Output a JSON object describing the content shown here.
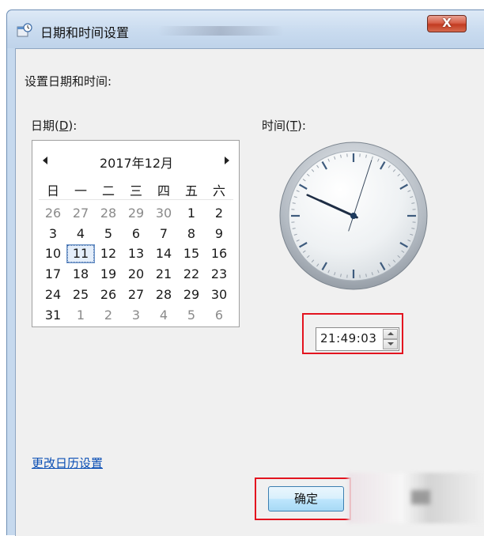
{
  "window": {
    "title": "日期和时间设置",
    "close_symbol": "X",
    "title_icon": "calendar-clock-icon"
  },
  "dialog": {
    "instruction": "设置日期和时间:",
    "date_label_text": "日期(",
    "date_label_key": "D",
    "date_label_end": "):",
    "time_label_text": "时间(",
    "time_label_key": "T",
    "time_label_end": "):"
  },
  "calendar": {
    "month_title": "2017年12月",
    "weekdays": [
      "日",
      "一",
      "二",
      "三",
      "四",
      "五",
      "六"
    ],
    "weeks": [
      [
        "26",
        "27",
        "28",
        "29",
        "30",
        "1",
        "2"
      ],
      [
        "3",
        "4",
        "5",
        "6",
        "7",
        "8",
        "9"
      ],
      [
        "10",
        "11",
        "12",
        "13",
        "14",
        "15",
        "16"
      ],
      [
        "17",
        "18",
        "19",
        "20",
        "21",
        "22",
        "23"
      ],
      [
        "24",
        "25",
        "26",
        "27",
        "28",
        "29",
        "30"
      ],
      [
        "31",
        "1",
        "2",
        "3",
        "4",
        "5",
        "6"
      ]
    ],
    "selected_day": "11"
  },
  "clock": {
    "hour": 21,
    "minute": 49,
    "second": 3
  },
  "time_input": {
    "value": "21:49:03"
  },
  "footer": {
    "change_calendar_link": "更改日历设置",
    "ok_button": "确定"
  },
  "colors": {
    "highlight_red": "#e3141f",
    "link_blue": "#0b4fb5"
  }
}
